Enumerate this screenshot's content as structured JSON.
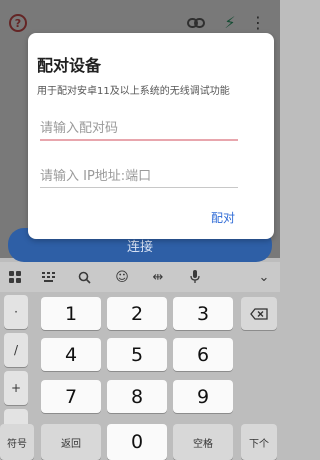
{
  "app": {
    "connect_button": "连接"
  },
  "dialog": {
    "title": "配对设备",
    "subtitle": "用于配对安卓11及以上系统的无线调试功能",
    "pairing_code_placeholder": "请输入配对码",
    "address_placeholder": "请输入 IP地址:端口",
    "confirm_button": "配对"
  },
  "keyboard": {
    "number_keys": [
      "1",
      "2",
      "3",
      "4",
      "5",
      "6",
      "7",
      "8",
      "9",
      "0"
    ],
    "symbol_keys": [
      "·",
      "/",
      "+",
      "-"
    ],
    "symbols_key": "符号",
    "back_key": "返回",
    "space_key": "空格",
    "next_key": "下个",
    "toolbar_icons": [
      "apps-icon",
      "grid-icon",
      "search-icon",
      "emoji-icon",
      "cursor-icon",
      "mic-icon",
      "chevron-down-icon"
    ]
  }
}
